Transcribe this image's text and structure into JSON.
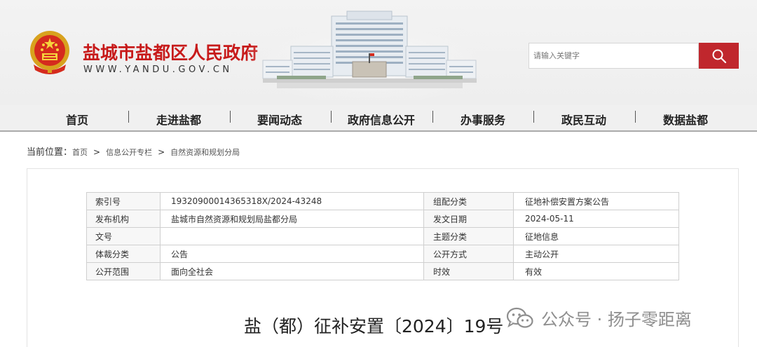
{
  "header": {
    "site_title": "盐城市盐都区人民政府",
    "site_domain": "WWW.YANDU.GOV.CN",
    "search_placeholder": "请输入关键字",
    "brand_color": "#c71a1a"
  },
  "nav": {
    "items": [
      "首页",
      "走进盐都",
      "要闻动态",
      "政府信息公开",
      "办事服务",
      "政民互动",
      "数据盐都"
    ]
  },
  "breadcrumb": {
    "label": "当前位置：",
    "items": [
      "首页",
      "信息公开专栏",
      "自然资源和规划分局"
    ],
    "separator": ">"
  },
  "meta_table": {
    "rows": [
      {
        "k1": "索引号",
        "v1": "1932090001436531​8X/2024-43248",
        "k2": "组配分类",
        "v2": "征地补偿安置方案公告"
      },
      {
        "k1": "发布机构",
        "v1": "盐城市自然资源和规划局盐都分局",
        "k2": "发文日期",
        "v2": "2024-05-11"
      },
      {
        "k1": "文号",
        "v1": "",
        "k2": "主题分类",
        "v2": "征地信息"
      },
      {
        "k1": "体裁分类",
        "v1": "公告",
        "k2": "公开方式",
        "v2": "主动公开"
      },
      {
        "k1": "公开范围",
        "v1": "面向全社会",
        "k2": "时效",
        "v2": "有效"
      }
    ]
  },
  "document": {
    "title": "盐（都）征补安置〔2024〕19号"
  },
  "watermark": {
    "text": "公众号 · 扬子零距离",
    "icon": "wechat-icon"
  }
}
